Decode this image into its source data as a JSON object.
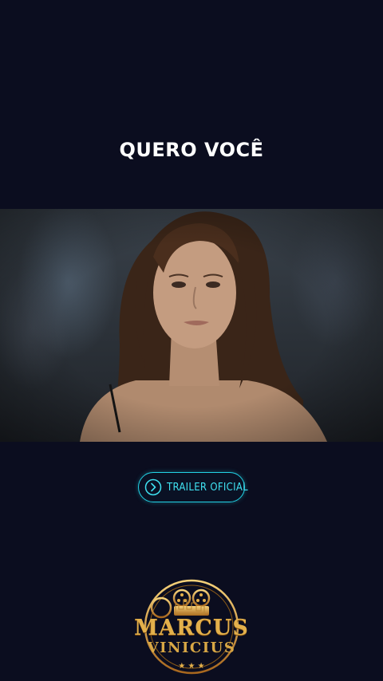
{
  "title": "QUERO VOCÊ",
  "trailer_button": {
    "label": "TRAILER OFICIAL",
    "icon": "chevron-right-circle-icon"
  },
  "logo": {
    "top": "MARCUS",
    "bottom": "VINICIUS"
  },
  "colors": {
    "background": "#0b0d1f",
    "accent": "#22d3e6",
    "gold": "#e3b04b"
  }
}
